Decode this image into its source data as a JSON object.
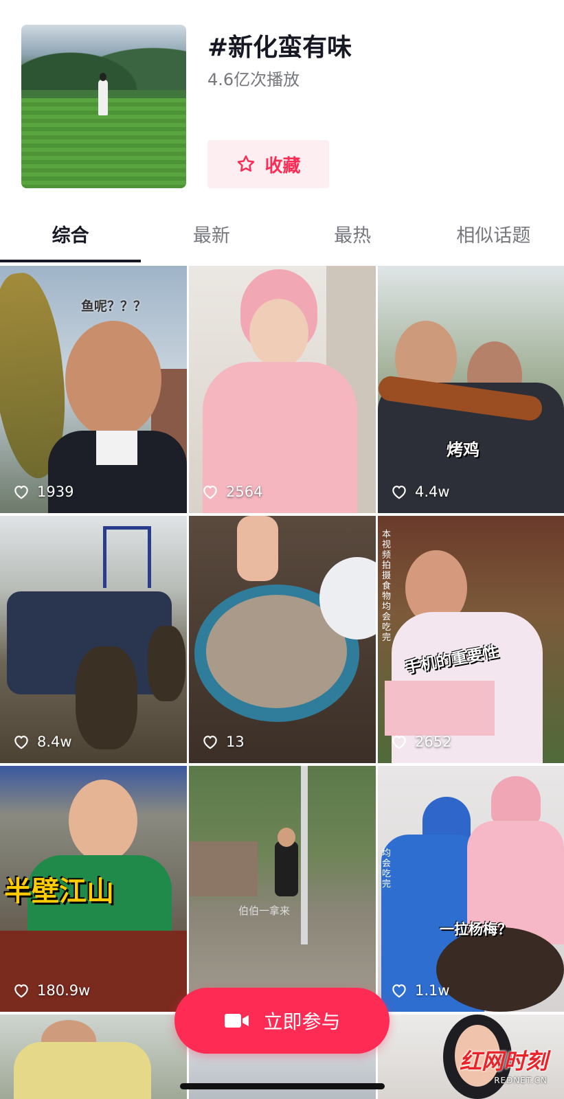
{
  "header": {
    "title": "#新化蛮有味",
    "plays": "4.6亿次播放",
    "favorite_label": "收藏"
  },
  "tabs": [
    {
      "label": "综合",
      "active": true
    },
    {
      "label": "最新",
      "active": false
    },
    {
      "label": "最热",
      "active": false
    },
    {
      "label": "相似话题",
      "active": false
    }
  ],
  "videos": [
    {
      "likes": "1939",
      "caption": "鱼呢？？？"
    },
    {
      "likes": "2564",
      "caption": ""
    },
    {
      "likes": "4.4w",
      "caption": "烤鸡"
    },
    {
      "likes": "8.4w",
      "caption": ""
    },
    {
      "likes": "13",
      "caption": ""
    },
    {
      "likes": "2652",
      "caption": "手机的重要性"
    },
    {
      "likes": "180.9w",
      "caption": "半壁江山"
    },
    {
      "likes": "",
      "caption": "伯伯一拿来"
    },
    {
      "likes": "1.1w",
      "caption": "一拉杨梅？"
    }
  ],
  "side_texts": {
    "v6": "本视频拍摄食物均会吃完",
    "v9": "均会吃完"
  },
  "cta": {
    "label": "立即参与"
  },
  "watermark": {
    "main": "红网时刻",
    "sub": "REDNET.CN"
  },
  "colors": {
    "accent": "#fe2c55",
    "favorite_bg": "#fdeff1"
  }
}
